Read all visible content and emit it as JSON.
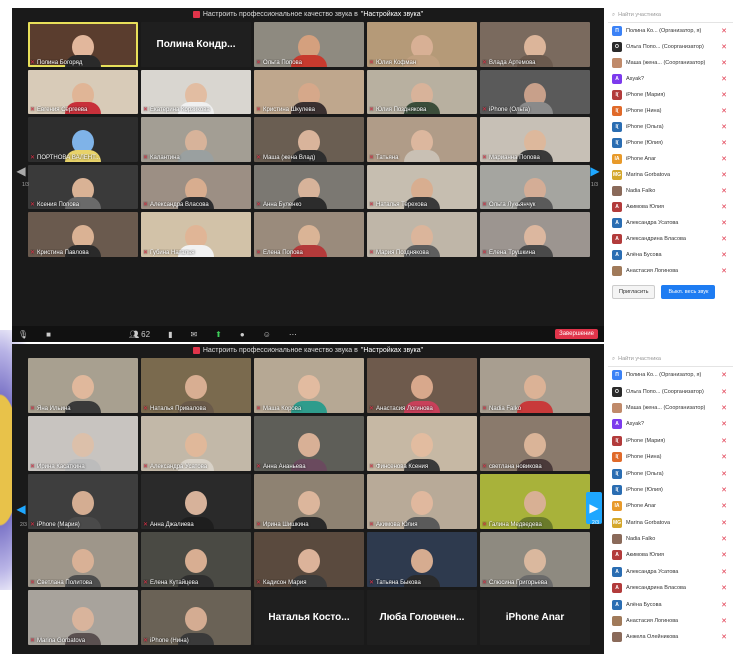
{
  "banner": {
    "text": "Настроить профессиональное качество звука в",
    "link": "\"Настройках звука\""
  },
  "colors": {
    "mute": "#e0344a",
    "accent": "#1e7cf2",
    "bg": "#1a1a1a"
  },
  "window1": {
    "page_left": "1/3",
    "page_right": "1/3",
    "tiles": [
      {
        "name": "Полина Богоряд",
        "bg": "#5a3d2e",
        "skin": "#e2b79c",
        "shirt": "#2a2a2a",
        "active": true
      },
      {
        "name": "Полина Кондр...",
        "textonly": true
      },
      {
        "name": "Ольга Попова",
        "bg": "#8e8a80",
        "skin": "#d4a07e",
        "shirt": "#c73a2e"
      },
      {
        "name": "Юлия Кофман",
        "bg": "#b59a78",
        "skin": "#d8b095",
        "shirt": "#c0a080"
      },
      {
        "name": "Влада Артемова",
        "bg": "#7a6a5e",
        "skin": "#dcb59a",
        "shirt": "#6b5a4e"
      },
      {
        "name": "Евгения Сергеева",
        "bg": "#d8cbb8",
        "skin": "#e0b596",
        "shirt": "#c8303a"
      },
      {
        "name": "Екатерина Корзикова",
        "bg": "#d9d6d0",
        "skin": "#e2bda2",
        "shirt": "#f0f0f0"
      },
      {
        "name": "Кристина Шкулева",
        "bg": "#bfa78d",
        "skin": "#d6a88a",
        "shirt": "#3a3030"
      },
      {
        "name": "Юлия Позднякова",
        "bg": "#b8b0a0",
        "skin": "#d8b39a",
        "shirt": "#3b4d3a"
      },
      {
        "name": "iPhone (Ольга)",
        "bg": "#5a5a5a",
        "skin": "#c8a08a",
        "shirt": "#8a8a8a"
      },
      {
        "name": "ПОРТНОВА ВАЛЕНТ...",
        "bg": "#2e2e2e",
        "skin": "#7fb3e8",
        "shirt": "#e8d36a"
      },
      {
        "name": "Калантина",
        "bg": "#a39e94",
        "skin": "#d7b39a",
        "shirt": "#9aa0a0"
      },
      {
        "name": "Маша (жена Влад)",
        "bg": "#6a5e52",
        "skin": "#d9b49b",
        "shirt": "#2e2e2e"
      },
      {
        "name": "Татьяна",
        "bg": "#b09c88",
        "skin": "#dcb79e",
        "shirt": "#c9c0b4"
      },
      {
        "name": "Марианна Попова",
        "bg": "#c7c0b6",
        "skin": "#ddb89c",
        "shirt": "#3a3a3a"
      },
      {
        "name": "Ксения Попова",
        "bg": "#3a3a3a",
        "skin": "#d9b295",
        "shirt": "#6a6a6a"
      },
      {
        "name": "Александра Власова",
        "bg": "#9c8f84",
        "skin": "#d8ad8f",
        "shirt": "#2e2e30"
      },
      {
        "name": "Анна Буленко",
        "bg": "#7b7872",
        "skin": "#d7b39a",
        "shirt": "#2c2c2c"
      },
      {
        "name": "Наталья Терехова",
        "bg": "#c6beb0",
        "skin": "#d8ae90",
        "shirt": "#3a3a3a"
      },
      {
        "name": "Ольга Лукьянчук",
        "bg": "#a5a5a0",
        "skin": "#d4ad96",
        "shirt": "#5a5a5a"
      },
      {
        "name": "Кристина Павлова",
        "bg": "#6a5a4e",
        "skin": "#dab294",
        "shirt": "#2a2a2a"
      },
      {
        "name": "Губина Наталья",
        "bg": "#d2c2a8",
        "skin": "#e0b596",
        "shirt": "#f2f2f2"
      },
      {
        "name": "Елена Попова",
        "bg": "#9a8b7c",
        "skin": "#dab496",
        "shirt": "#b43a3a"
      },
      {
        "name": "Мария Позднякова",
        "bg": "#bfb6a8",
        "skin": "#dbb59b",
        "shirt": "#5e5e5e"
      },
      {
        "name": "Елена Трушкина",
        "bg": "#9c9590",
        "skin": "#dcb79f",
        "shirt": "#4a4a4a"
      }
    ],
    "toolbar": {
      "participants": "62",
      "end_label": "Завершение"
    }
  },
  "panel1": {
    "search": "Найти участника",
    "participants": [
      {
        "initial": "П",
        "name": "Полина Ко... (Организатор, я)",
        "color": "#3b82f6"
      },
      {
        "initial": "О",
        "name": "Ольга Попо... (Соорганизатор)",
        "color": "#2a2a2a"
      },
      {
        "initial": "",
        "name": "Маша (жена... (Соорганизатор)",
        "color": "#c08a6a"
      },
      {
        "initial": "A",
        "name": "Asyak?",
        "color": "#7c3aed"
      },
      {
        "initial": "I(",
        "name": "iPhone (Мария)",
        "color": "#b23b3b"
      },
      {
        "initial": "I(",
        "name": "iPhone (Нина)",
        "color": "#e06a2a"
      },
      {
        "initial": "I(",
        "name": "iPhone (Ольга)",
        "color": "#2a6db2"
      },
      {
        "initial": "I(",
        "name": "iPhone (Юлия)",
        "color": "#2a6db2"
      },
      {
        "initial": "IA",
        "name": "iPhone Anar",
        "color": "#e89a2a"
      },
      {
        "initial": "MG",
        "name": "Marina Gorbatova",
        "color": "#d4a72c"
      },
      {
        "initial": "",
        "name": "Nadia Falko",
        "color": "#8a6a5a"
      },
      {
        "initial": "A",
        "name": "Акимова Юлия",
        "color": "#b23b3b"
      },
      {
        "initial": "A",
        "name": "Александра Усатова",
        "color": "#2a6db2"
      },
      {
        "initial": "A",
        "name": "Александрина Власова",
        "color": "#b23b3b"
      },
      {
        "initial": "A",
        "name": "Алёна Бусова",
        "color": "#2a6db2"
      },
      {
        "initial": "",
        "name": "Анастасия Логинова",
        "color": "#a07a5a"
      }
    ],
    "invite": "Пригласить",
    "mute_all": "Выкл. весь звук"
  },
  "window2": {
    "page_left": "2/3",
    "page_right": "2/3",
    "tiles": [
      {
        "name": "Яна Ильина",
        "bg": "#a8a090",
        "skin": "#e0b89c",
        "shirt": "#3a3a3a"
      },
      {
        "name": "Наталья Привалова",
        "bg": "#7a6a4e",
        "skin": "#d8ae92",
        "shirt": "#6a5a4a"
      },
      {
        "name": "Маша Корова",
        "bg": "#b6a894",
        "skin": "#e2bba0",
        "shirt": "#2e9c8c"
      },
      {
        "name": "Анастасия Логинова",
        "bg": "#6e5a4c",
        "skin": "#d8a88c",
        "shirt": "#c8405a"
      },
      {
        "name": "Nadia Falko",
        "bg": "#a89e90",
        "skin": "#dbb296",
        "shirt": "#c83a3a"
      },
      {
        "name": "Ирина Касаткина",
        "bg": "#c8c4c0",
        "skin": "#dcc0aa",
        "shirt": "#bcbcbc"
      },
      {
        "name": "Александра Усатова",
        "bg": "#c2b8a8",
        "skin": "#e0b89a",
        "shirt": "#d8d2c8"
      },
      {
        "name": "Анна Ананьева",
        "bg": "#5e5e58",
        "skin": "#d8b096",
        "shirt": "#6a4a5e"
      },
      {
        "name": "Финсенова Ксения",
        "bg": "#c6b8a4",
        "skin": "#e2bca0",
        "shirt": "#3a3a3a"
      },
      {
        "name": "светлана новикова",
        "bg": "#8a7a6c",
        "skin": "#dab498",
        "shirt": "#4a3a3a"
      },
      {
        "name": "iPhone (Мария)",
        "bg": "#3e3e3e",
        "skin": "#d4ad92",
        "shirt": "#4a4a4a"
      },
      {
        "name": "Анна Джалиева",
        "bg": "#2a2a2a",
        "skin": "#d7b29a",
        "shirt": "#1e1e1e"
      },
      {
        "name": "Ирина Шишкина",
        "bg": "#8e8272",
        "skin": "#dcb69c",
        "shirt": "#2a2a2a"
      },
      {
        "name": "Акимова Юлия",
        "bg": "#b8aa98",
        "skin": "#e0b89e",
        "shirt": "#5a5a5a"
      },
      {
        "name": "Галина Медведева",
        "bg": "#a8b23a",
        "skin": "#d8b094",
        "shirt": "#6a7a2a"
      },
      {
        "name": "Светлана Политова",
        "bg": "#9e968a",
        "skin": "#d9b196",
        "shirt": "#4e4e4e"
      },
      {
        "name": "Елена Кутайцева",
        "bg": "#4a4a44",
        "skin": "#d8ae92",
        "shirt": "#2e2e2e"
      },
      {
        "name": "Кадисон Мария",
        "bg": "#5a4a3e",
        "skin": "#dcb39a",
        "shirt": "#3a3a3a"
      },
      {
        "name": "Татьяна Быкова",
        "bg": "#2e3a4e",
        "skin": "#d6ac90",
        "shirt": "#2a2a2a"
      },
      {
        "name": "Слюсина Григорьева",
        "bg": "#8e8a80",
        "skin": "#dab89e",
        "shirt": "#6a6a6a"
      },
      {
        "name": "Marina Gorbatova",
        "bg": "#a8a39c",
        "skin": "#d9b49c",
        "shirt": "#5a5050"
      },
      {
        "name": "iPhone (Нина)",
        "bg": "#6a6256",
        "skin": "#d4ac92",
        "shirt": "#3a3a3a"
      },
      {
        "name": "Наталья Косто...",
        "textonly": true
      },
      {
        "name": "Люба Головчен...",
        "textonly": true
      },
      {
        "name": "iPhone Anar",
        "textonly": true
      }
    ]
  },
  "panel2": {
    "search": "Найти участника",
    "participants": [
      {
        "initial": "П",
        "name": "Полина Ко... (Организатор, я)",
        "color": "#3b82f6"
      },
      {
        "initial": "О",
        "name": "Ольга Попо... (Соорганизатор)",
        "color": "#2a2a2a"
      },
      {
        "initial": "",
        "name": "Маша (жена... (Соорганизатор)",
        "color": "#c08a6a"
      },
      {
        "initial": "A",
        "name": "Asyak?",
        "color": "#7c3aed"
      },
      {
        "initial": "I(",
        "name": "iPhone (Мария)",
        "color": "#b23b3b"
      },
      {
        "initial": "I(",
        "name": "iPhone (Нина)",
        "color": "#e06a2a"
      },
      {
        "initial": "I(",
        "name": "iPhone (Ольга)",
        "color": "#2a6db2"
      },
      {
        "initial": "I(",
        "name": "iPhone (Юлия)",
        "color": "#2a6db2"
      },
      {
        "initial": "IA",
        "name": "iPhone Anar",
        "color": "#e89a2a"
      },
      {
        "initial": "MG",
        "name": "Marina Gorbatova",
        "color": "#d4a72c"
      },
      {
        "initial": "",
        "name": "Nadia Falko",
        "color": "#8a6a5a"
      },
      {
        "initial": "A",
        "name": "Акимова Юлия",
        "color": "#b23b3b"
      },
      {
        "initial": "A",
        "name": "Александра Усатова",
        "color": "#2a6db2"
      },
      {
        "initial": "A",
        "name": "Александрина Власова",
        "color": "#b23b3b"
      },
      {
        "initial": "A",
        "name": "Алёна Бусова",
        "color": "#2a6db2"
      },
      {
        "initial": "",
        "name": "Анастасия Логинова",
        "color": "#a07a5a"
      },
      {
        "initial": "",
        "name": "Анжела Олейникова",
        "color": "#8a6a5a"
      }
    ]
  }
}
